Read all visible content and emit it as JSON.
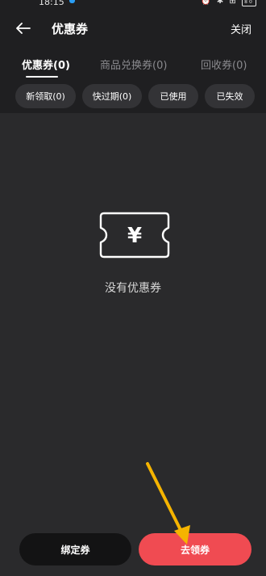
{
  "status_bar": {
    "time": "18:15",
    "icons": "⏰ ✱ ⊞",
    "battery": "80"
  },
  "header": {
    "title": "优惠券",
    "close_label": "关闭"
  },
  "tabs": [
    {
      "label": "优惠券(0)",
      "active": true
    },
    {
      "label": "商品兑换券(0)",
      "active": false
    },
    {
      "label": "回收券(0)",
      "active": false
    }
  ],
  "filters": [
    {
      "label": "新领取(0)"
    },
    {
      "label": "快过期(0)"
    },
    {
      "label": "已使用"
    },
    {
      "label": "已失效"
    }
  ],
  "empty_state": {
    "icon_symbol": "¥",
    "message": "没有优惠券"
  },
  "bottom": {
    "bind_label": "绑定券",
    "get_label": "去领券"
  },
  "colors": {
    "background": "#2a2a2c",
    "header_bg": "#1f1f21",
    "chip_bg": "#333336",
    "primary_button": "#f04b52",
    "secondary_button": "#131314",
    "annotation_arrow": "#f5b400"
  }
}
